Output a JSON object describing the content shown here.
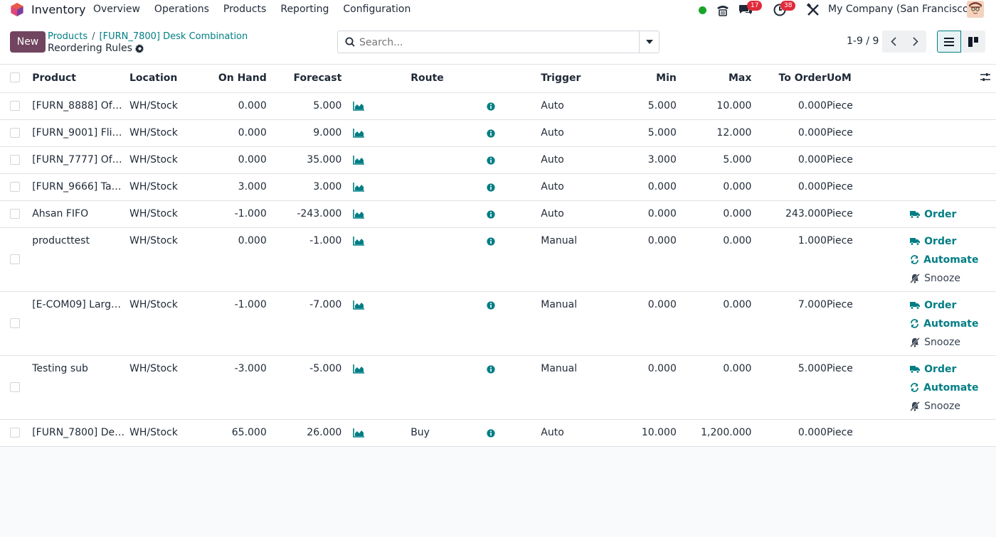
{
  "navbar": {
    "app_name": "Inventory",
    "menu": [
      "Overview",
      "Operations",
      "Products",
      "Reporting",
      "Configuration"
    ],
    "messages_count": "17",
    "activities_count": "38",
    "company": "My Company (San Francisco)"
  },
  "control_panel": {
    "new_label": "New",
    "breadcrumb": [
      "Products",
      "[FURN_7800] Desk Combination"
    ],
    "title": "Reordering Rules",
    "search_placeholder": "Search...",
    "pager": "1-9 / 9"
  },
  "table": {
    "headers": {
      "product": "Product",
      "location": "Location",
      "on_hand": "On Hand",
      "forecast": "Forecast",
      "route": "Route",
      "trigger": "Trigger",
      "min": "Min",
      "max": "Max",
      "to_order": "To Order",
      "uom": "UoM"
    },
    "rows": [
      {
        "product": "[FURN_8888] Of…",
        "location": "WH/Stock",
        "on_hand": "0.000",
        "forecast": "5.000",
        "route": "",
        "trigger": "Auto",
        "min": "5.000",
        "max": "10.000",
        "to_order": "0.000",
        "uom": "Piece",
        "actions": []
      },
      {
        "product": "[FURN_9001] Fli…",
        "location": "WH/Stock",
        "on_hand": "0.000",
        "forecast": "9.000",
        "route": "",
        "trigger": "Auto",
        "min": "5.000",
        "max": "12.000",
        "to_order": "0.000",
        "uom": "Piece",
        "actions": []
      },
      {
        "product": "[FURN_7777] Of…",
        "location": "WH/Stock",
        "on_hand": "0.000",
        "forecast": "35.000",
        "route": "",
        "trigger": "Auto",
        "min": "3.000",
        "max": "5.000",
        "to_order": "0.000",
        "uom": "Piece",
        "actions": []
      },
      {
        "product": "[FURN_9666] Ta…",
        "location": "WH/Stock",
        "on_hand": "3.000",
        "forecast": "3.000",
        "route": "",
        "trigger": "Auto",
        "min": "0.000",
        "max": "0.000",
        "to_order": "0.000",
        "uom": "Piece",
        "actions": []
      },
      {
        "product": "Ahsan FIFO",
        "location": "WH/Stock",
        "on_hand": "-1.000",
        "forecast": "-243.000",
        "route": "",
        "trigger": "Auto",
        "min": "0.000",
        "max": "0.000",
        "to_order": "243.000",
        "uom": "Piece",
        "actions": [
          "Order"
        ]
      },
      {
        "product": "producttest",
        "location": "WH/Stock",
        "on_hand": "0.000",
        "forecast": "-1.000",
        "route": "",
        "trigger": "Manual",
        "min": "0.000",
        "max": "0.000",
        "to_order": "1.000",
        "uom": "Piece",
        "actions": [
          "Order",
          "Automate",
          "Snooze"
        ]
      },
      {
        "product": "[E-COM09] Larg…",
        "location": "WH/Stock",
        "on_hand": "-1.000",
        "forecast": "-7.000",
        "route": "",
        "trigger": "Manual",
        "min": "0.000",
        "max": "0.000",
        "to_order": "7.000",
        "uom": "Piece",
        "actions": [
          "Order",
          "Automate",
          "Snooze"
        ]
      },
      {
        "product": "Testing sub",
        "location": "WH/Stock",
        "on_hand": "-3.000",
        "forecast": "-5.000",
        "route": "",
        "trigger": "Manual",
        "min": "0.000",
        "max": "0.000",
        "to_order": "5.000",
        "uom": "Piece",
        "actions": [
          "Order",
          "Automate",
          "Snooze"
        ]
      },
      {
        "product": "[FURN_7800] De…",
        "location": "WH/Stock",
        "on_hand": "65.000",
        "forecast": "26.000",
        "route": "Buy",
        "trigger": "Auto",
        "min": "10.000",
        "max": "1,200.000",
        "to_order": "0.000",
        "uom": "Piece",
        "actions": []
      }
    ]
  },
  "colors": {
    "brand": "#71445f",
    "accent": "#017e84",
    "badge": "#e02b3a",
    "online": "#1aa52a"
  }
}
